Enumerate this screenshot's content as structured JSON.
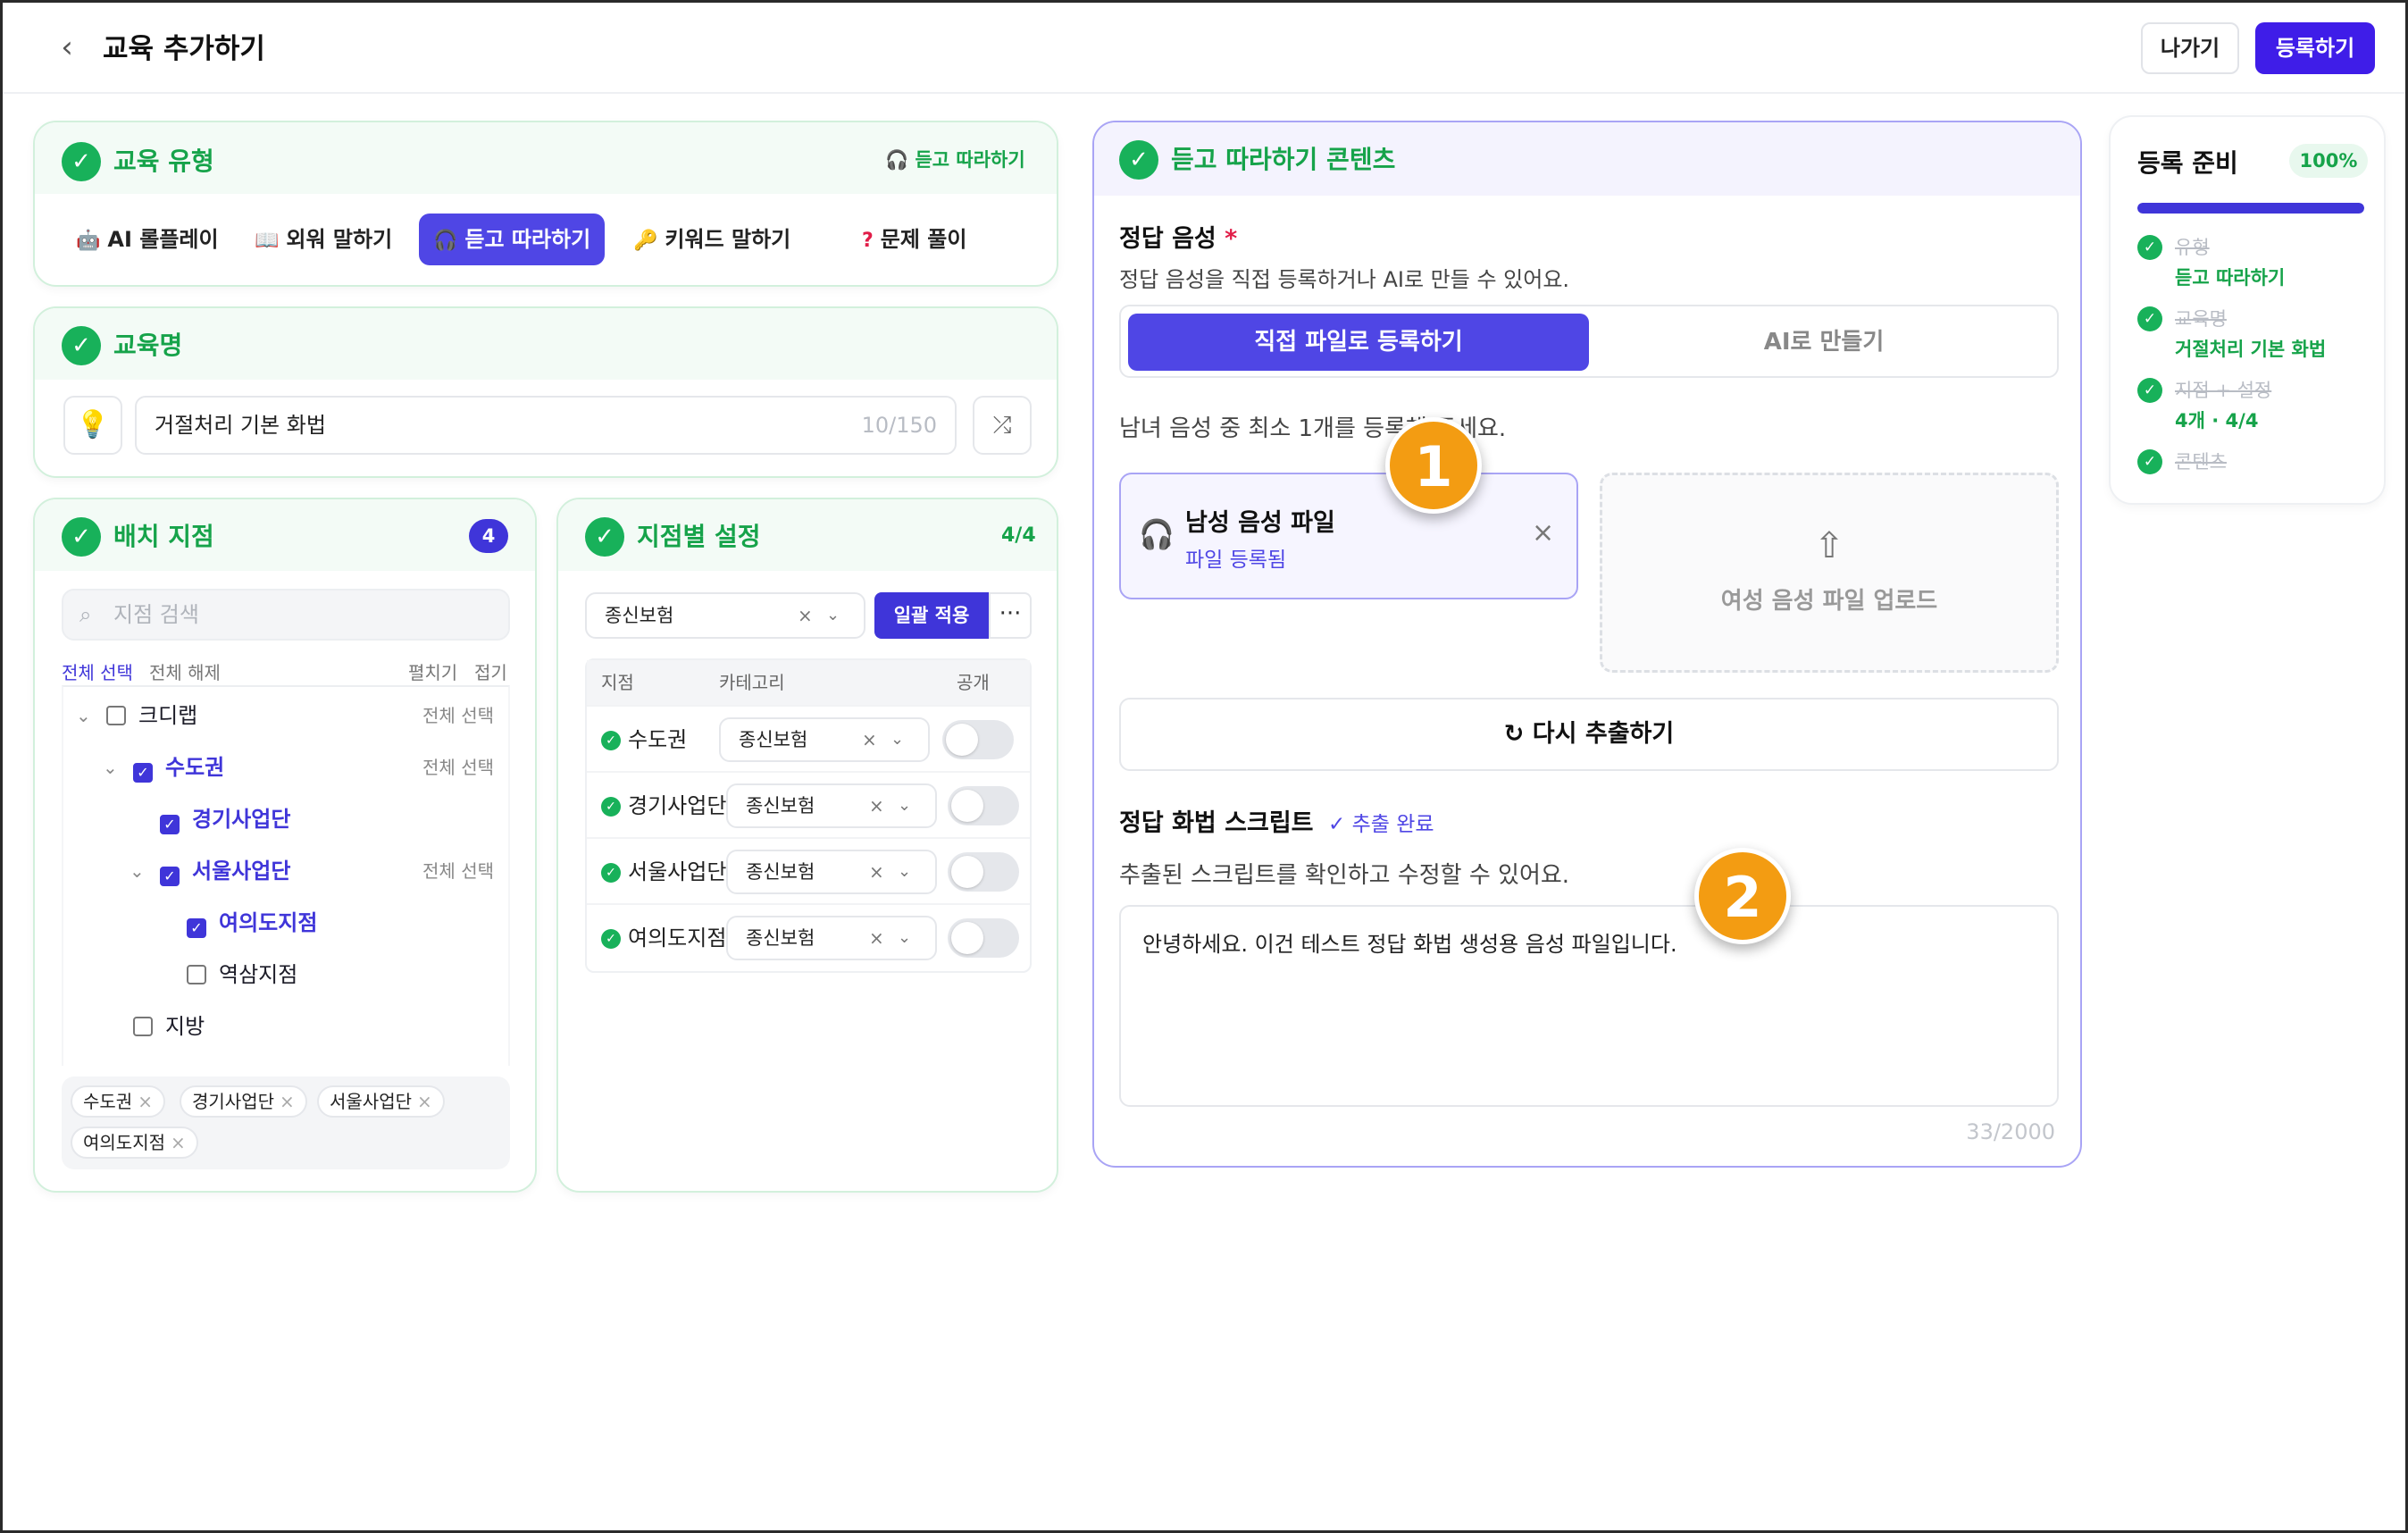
{
  "header": {
    "back_icon": "chevron-left-icon",
    "title": "교육 추가하기",
    "exit_label": "나가기",
    "submit_label": "등록하기"
  },
  "edu_type": {
    "title": "교육 유형",
    "selected_chip": "듣고 따라하기",
    "tabs": [
      {
        "icon": "robot-icon",
        "label": "AI 롤플레이",
        "active": false
      },
      {
        "icon": "book-icon",
        "label": "외워 말하기",
        "active": false
      },
      {
        "icon": "headphones-icon",
        "label": "듣고 따라하기",
        "active": true
      },
      {
        "icon": "key-icon",
        "label": "키워드 말하기",
        "active": false
      },
      {
        "icon": "question-icon",
        "label": "문제 풀이",
        "active": false
      }
    ]
  },
  "edu_name": {
    "title": "교육명",
    "value": "거절처리 기본 화법",
    "count": "10/150"
  },
  "branch": {
    "title": "배치 지점",
    "count": "4",
    "search_placeholder": "지점 검색",
    "select_all": "전체 선택",
    "deselect_all": "전체 해제",
    "expand": "펼치기",
    "collapse": "접기",
    "tree": [
      {
        "label": "크디랩",
        "checked": false,
        "all": "전체 선택"
      },
      {
        "label": "수도권",
        "checked": true,
        "all": "전체 선택"
      },
      {
        "label": "경기사업단",
        "checked": true,
        "all": ""
      },
      {
        "label": "서울사업단",
        "checked": true,
        "all": "전체 선택"
      },
      {
        "label": "여의도지점",
        "checked": true,
        "all": ""
      },
      {
        "label": "역삼지점",
        "checked": false,
        "all": ""
      },
      {
        "label": "지방",
        "checked": false,
        "all": ""
      }
    ],
    "tags": [
      "수도권",
      "경기사업단",
      "서울사업단",
      "여의도지점"
    ]
  },
  "per_branch": {
    "title": "지점별 설정",
    "count": "4/4",
    "bulk_select": "종신보험",
    "apply_label": "일괄 적용",
    "more_label": "···",
    "col_branch": "지점",
    "col_category": "카테고리",
    "col_public": "공개",
    "rows": [
      {
        "name": "수도권",
        "category": "종신보험"
      },
      {
        "name": "경기사업단",
        "category": "종신보험"
      },
      {
        "name": "서울사업단",
        "category": "종신보험"
      },
      {
        "name": "여의도지점",
        "category": "종신보험"
      }
    ]
  },
  "content": {
    "title": "듣고 따라하기 콘텐츠",
    "answer_voice_title": "정답 음성",
    "required_mark": "*",
    "answer_voice_desc": "정답 음성을 직접 등록하거나 AI로 만들 수 있어요.",
    "seg_direct": "직접 파일로 등록하기",
    "seg_ai": "AI로 만들기",
    "min_note": "남녀 음성 중 최소 1개를 등록해 주세요.",
    "male_file_title": "남성 음성 파일",
    "male_file_status": "파일 등록됨",
    "female_upload": "여성 음성 파일 업로드",
    "reextract": "다시 추출하기",
    "script_title": "정답 화법 스크립트",
    "script_status": "✓ 추출 완료",
    "script_desc": "추출된 스크립트를 확인하고 수정할 수 있어요.",
    "script_text": "안녕하세요. 이건 테스트 정답 화법 생성용 음성 파일입니다.",
    "script_count": "33/2000"
  },
  "callouts": {
    "one": "1",
    "two": "2"
  },
  "ready": {
    "title": "등록 준비",
    "percent_label": "100%",
    "progress": 100,
    "steps": [
      {
        "label": "유형",
        "sub": "듣고 따라하기"
      },
      {
        "label": "교육명",
        "sub": "거절처리 기본 화법"
      },
      {
        "label": "지점 + 설정",
        "sub": "4개 · 4/4"
      },
      {
        "label": "콘텐츠",
        "sub": ""
      }
    ]
  },
  "colors": {
    "accent": "#4f46e5",
    "primary_button": "#3f1de8",
    "success": "#18b15a",
    "success_text": "#16a34a"
  }
}
